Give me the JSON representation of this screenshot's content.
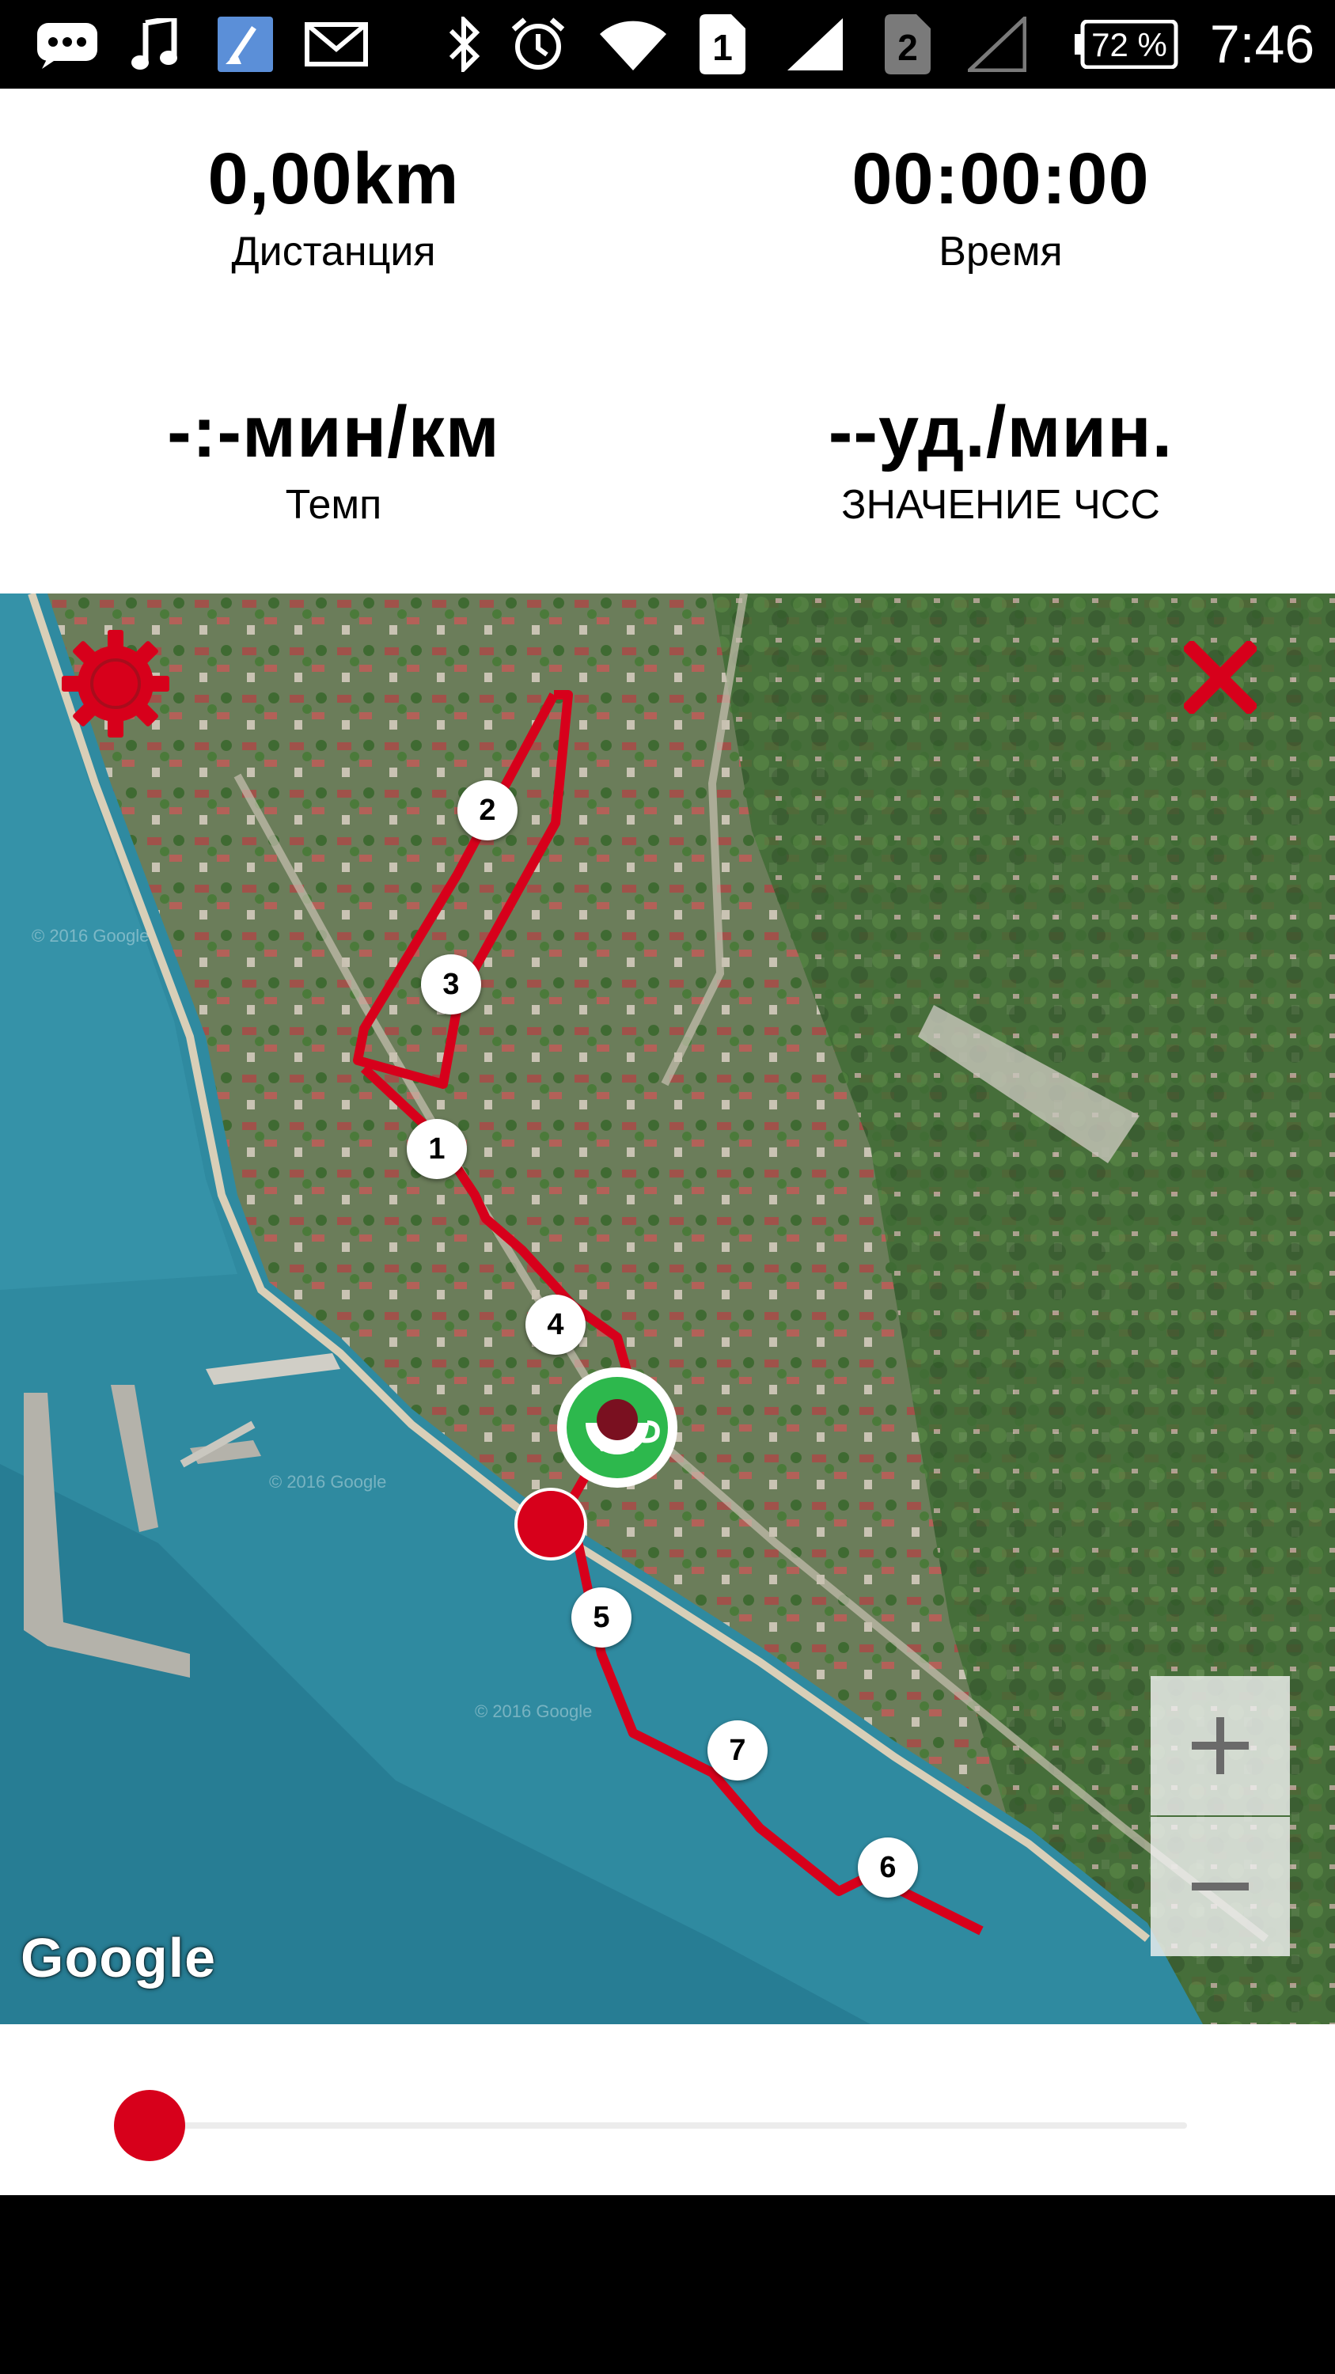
{
  "status_bar": {
    "icons": [
      "messages-icon",
      "music-note-icon",
      "clean-master-icon",
      "mail-icon",
      "bluetooth-icon",
      "alarm-icon",
      "wifi-icon",
      "sim-1-icon",
      "signal-icon",
      "sim-2-icon",
      "no-signal-icon",
      "battery-icon"
    ],
    "sim1": "1",
    "sim2": "2",
    "battery": "72 %",
    "time": "7:46"
  },
  "stats": {
    "distance": {
      "value": "0,00km",
      "label": "Дистанция"
    },
    "time": {
      "value": "00:00:00",
      "label": "Время"
    },
    "pace": {
      "value": "-:-мин/км",
      "label": "Темп"
    },
    "heart_rate": {
      "value": "--уд./мин.",
      "label": "ЗНАЧЕНИЕ ЧСС"
    }
  },
  "map": {
    "provider_logo": "Google",
    "route_color": "#d7001b",
    "markers": [
      "1",
      "2",
      "3",
      "4",
      "5",
      "6",
      "7"
    ],
    "settings_icon": "gear-icon",
    "close_icon": "close-icon",
    "zoom_in_icon": "plus-icon",
    "zoom_out_icon": "minus-icon",
    "current_position_icon": "coffee-cup-icon",
    "current_position_color": "#2db84d"
  },
  "slider": {
    "value": 0,
    "accent": "#d7001b"
  },
  "nav_bar": {
    "icons": [
      "back-icon",
      "home-icon",
      "recents-icon"
    ]
  }
}
